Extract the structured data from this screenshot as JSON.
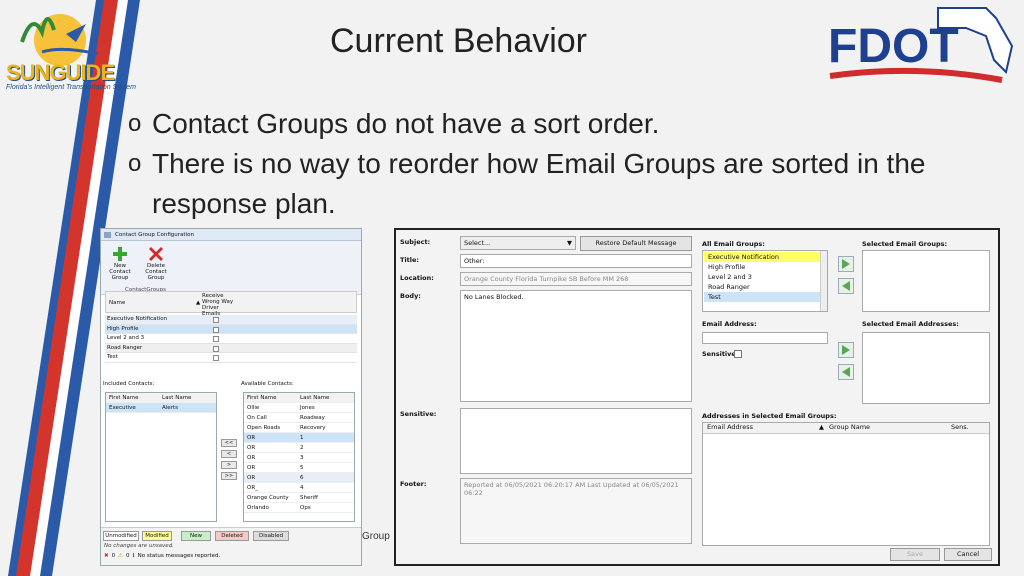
{
  "slide": {
    "title": "Current Behavior",
    "bullets": [
      "Contact Groups do not have a sort order.",
      "There is no way to reorder how Email Groups are sorted in the response plan."
    ],
    "logo_text": "SUNGUIDE",
    "logo_sub": "Florida's Intelligent Transportation System",
    "fdot_text": "FDOT",
    "group_fragment": "Group"
  },
  "colors": {
    "fdot_blue": "#1f3f8f",
    "fdot_red": "#d12b2b",
    "highlight": "#ffff66",
    "selected": "#cde3f7"
  },
  "contact_dialog": {
    "title": "Contact Group Configuration",
    "ribbon": {
      "new_label": "New Contact Group",
      "delete_label": "Delete Contact Group",
      "group_label": "ContactGroups"
    },
    "grid_headers": {
      "name": "Name",
      "receive": "Receive Wrong Way Driver Emails"
    },
    "groups": [
      "Executive Notification",
      "High Profile",
      "Level 2 and 3",
      "Road Ranger",
      "Test"
    ],
    "included_label": "Included Contacts:",
    "available_label": "Available Contacts:",
    "col_first": "First Name",
    "col_last": "Last Name",
    "included": [
      {
        "first": "Executive",
        "last": "Alerts"
      }
    ],
    "available": [
      {
        "first": "Ollie",
        "last": "Jones"
      },
      {
        "first": "On Call",
        "last": "Roadway"
      },
      {
        "first": "Open Roads",
        "last": "Recovery"
      },
      {
        "first": "OR",
        "last": "1"
      },
      {
        "first": "OR",
        "last": "2"
      },
      {
        "first": "OR",
        "last": "3"
      },
      {
        "first": "OR",
        "last": "5"
      },
      {
        "first": "OR",
        "last": "6"
      },
      {
        "first": "OR_",
        "last": "4"
      },
      {
        "first": "Orange County",
        "last": "Sheriff"
      },
      {
        "first": "Orlando",
        "last": "Ops"
      }
    ],
    "move_buttons": [
      "<<",
      "<",
      ">",
      ">>"
    ],
    "status_chips": [
      "Unmodified",
      "Modified",
      "New",
      "Deleted",
      "Disabled"
    ],
    "unsaved": "No changes are unsaved.",
    "counts": {
      "errors": "0",
      "warnings": "0"
    },
    "status_msg": "No status messages reported."
  },
  "email_dialog": {
    "subject_label": "Subject:",
    "subject_value": "Select...",
    "restore_label": "Restore Default Message",
    "title_label": "Title:",
    "title_value": "Other:",
    "location_label": "Location:",
    "location_value": "Orange County Florida Turnpike SB Before MM 268",
    "body_label": "Body:",
    "body_value": "No Lanes Blocked.",
    "sensitive_label": "Sensitive:",
    "footer_label": "Footer:",
    "footer_value": "Reported at 06/05/2021 06:20:17 AM Last Updated at 06/05/2021 06:22",
    "all_groups_label": "All Email Groups:",
    "all_groups": [
      "Executive Notification",
      "High Profile",
      "Level 2 and 3",
      "Road Ranger",
      "Test"
    ],
    "selected_groups_label": "Selected Email Groups:",
    "email_address_label": "Email Address:",
    "selected_addresses_label": "Selected Email Addresses:",
    "sensitive_cb_label": "Sensitive:",
    "addresses_label": "Addresses in Selected Email Groups:",
    "addr_cols": {
      "email": "Email Address",
      "group": "Group Name",
      "sens": "Sens."
    },
    "save_label": "Save",
    "cancel_label": "Cancel"
  }
}
